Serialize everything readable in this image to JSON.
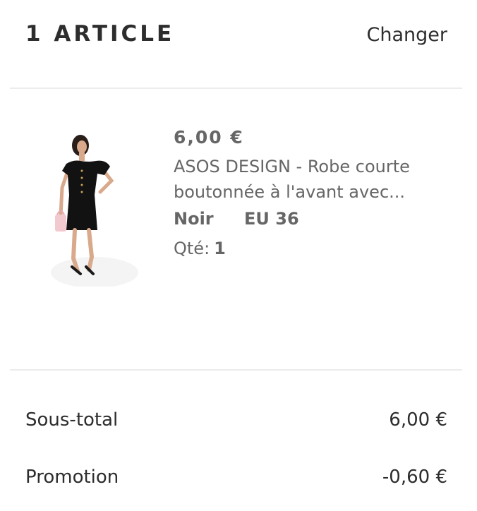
{
  "header": {
    "title": "1 ARTICLE",
    "change_label": "Changer"
  },
  "item": {
    "image_icon": "dress-product-photo",
    "price": "6,00 €",
    "name": "ASOS DESIGN - Robe courte boutonnée à l'avant avec...",
    "color": "Noir",
    "size": "EU 36",
    "qty_label": "Qté:",
    "qty_value": "1"
  },
  "summary": {
    "subtotal_label": "Sous-total",
    "subtotal_value": "6,00 €",
    "promotion_label": "Promotion",
    "promotion_value": "-0,60 €"
  }
}
